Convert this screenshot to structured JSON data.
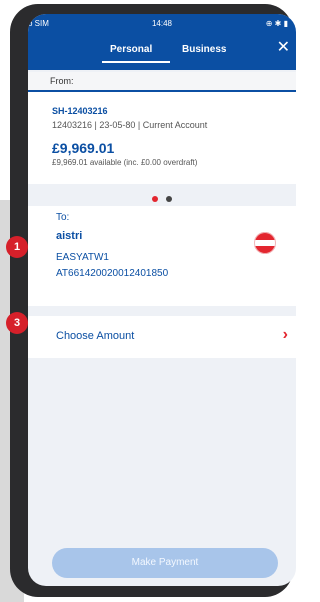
{
  "status_bar": {
    "carrier": "o SIM",
    "time": "14:48",
    "icons": "⊕ ✱ ▮"
  },
  "tabs": {
    "personal": "Personal",
    "business": "Business",
    "active": "Personal"
  },
  "close_icon": "✕",
  "from": {
    "label": "From:",
    "account_code": "SH-12403216",
    "account_detail": "12403216 | 23-05-80 | Current Account",
    "balance": "£9,969.01",
    "available": "£9,969.01 available (inc. £0.00 overdraft)"
  },
  "pager": {
    "pages": 2,
    "active_index": 0
  },
  "to": {
    "label": "To:",
    "name": "aistri",
    "bic": "EASYATW1",
    "iban": "AT661420020012401850",
    "flag_icon": "austria-flag-icon"
  },
  "amount": {
    "label": "Choose Amount",
    "chevron": "›"
  },
  "make_payment": {
    "label": "Make Payment"
  },
  "annotations": {
    "badge_1": "1",
    "badge_3": "3"
  },
  "colors": {
    "brand_blue": "#0b4fa3",
    "accent_red": "#e3262f",
    "disabled_button": "#a8c5ea"
  }
}
